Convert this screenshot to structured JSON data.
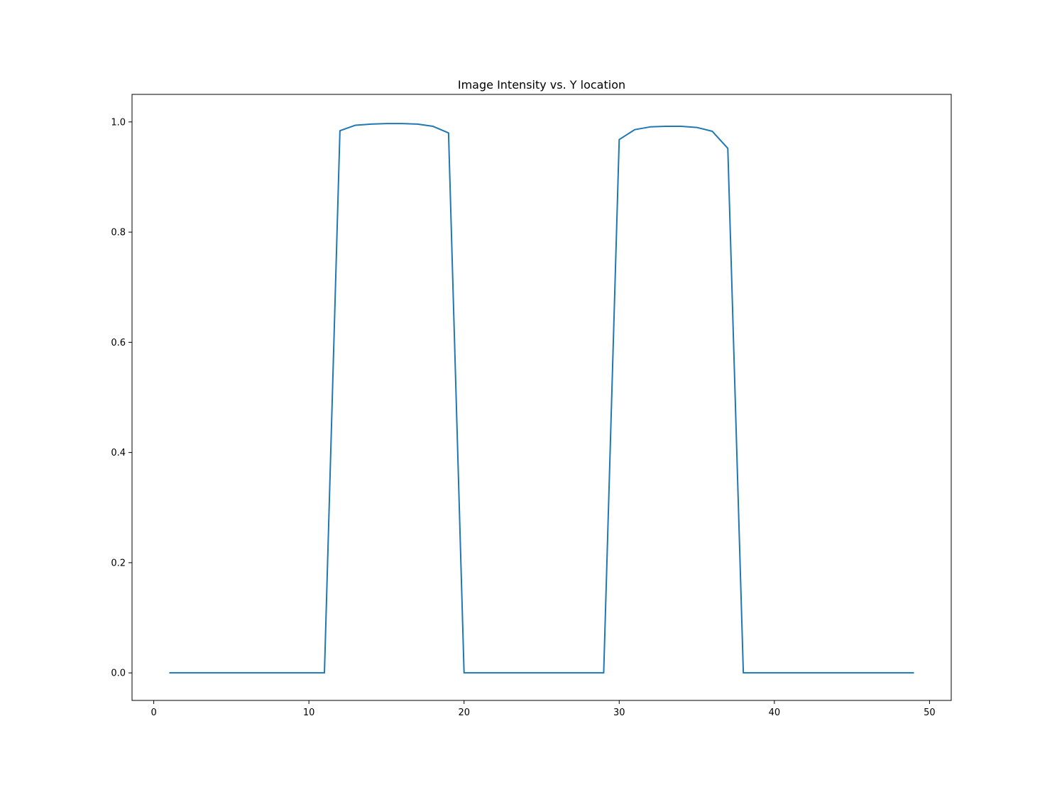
{
  "chart_data": {
    "type": "line",
    "title": "Image Intensity vs. Y location",
    "xlabel": "",
    "ylabel": "",
    "xlim": [
      -1.4,
      51.4
    ],
    "ylim": [
      -0.05,
      1.05
    ],
    "xticks": [
      0,
      10,
      20,
      30,
      40,
      50
    ],
    "yticks": [
      0.0,
      0.2,
      0.4,
      0.6,
      0.8,
      1.0
    ],
    "xtick_labels": [
      "0",
      "10",
      "20",
      "30",
      "40",
      "50"
    ],
    "ytick_labels": [
      "0.0",
      "0.2",
      "0.4",
      "0.6",
      "0.8",
      "1.0"
    ],
    "grid": false,
    "series": [
      {
        "color": "#1f77b4",
        "x": [
          1,
          2,
          3,
          4,
          5,
          6,
          7,
          8,
          9,
          10,
          11,
          12,
          13,
          14,
          15,
          16,
          17,
          18,
          19,
          20,
          21,
          22,
          23,
          24,
          25,
          26,
          27,
          28,
          29,
          30,
          31,
          32,
          33,
          34,
          35,
          36,
          37,
          38,
          39,
          40,
          41,
          42,
          43,
          44,
          45,
          46,
          47,
          48,
          49
        ],
        "y": [
          0,
          0,
          0,
          0,
          0,
          0,
          0,
          0,
          0,
          0,
          0,
          0.984,
          0.994,
          0.996,
          0.997,
          0.997,
          0.996,
          0.992,
          0.98,
          0,
          0,
          0,
          0,
          0,
          0,
          0,
          0,
          0,
          0,
          0.968,
          0.986,
          0.991,
          0.992,
          0.992,
          0.99,
          0.983,
          0.952,
          0,
          0,
          0,
          0,
          0,
          0,
          0,
          0,
          0,
          0,
          0,
          0
        ]
      }
    ]
  }
}
